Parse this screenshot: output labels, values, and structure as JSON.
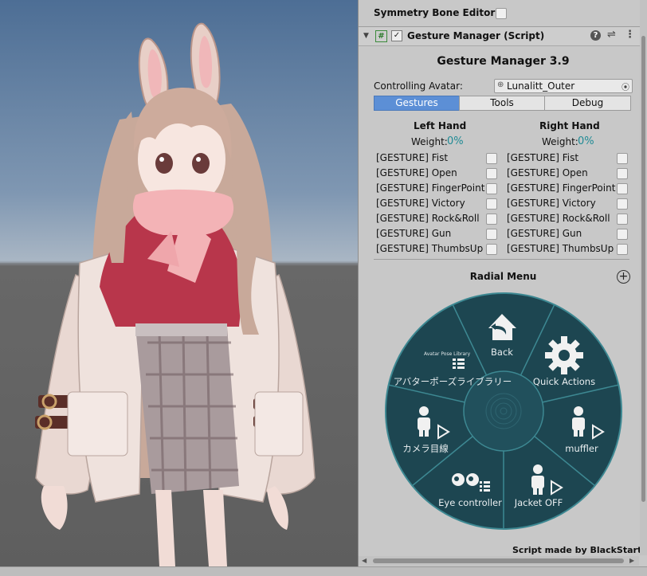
{
  "inspector": {
    "symmetry_label": "Symmetry Bone Editor",
    "component_title": "Gesture Manager (Script)",
    "heading": "Gesture Manager 3.9",
    "controlling_label": "Controlling Avatar:",
    "avatar_name": "Lunalitt_Outer",
    "tabs": [
      "Gestures",
      "Tools",
      "Debug"
    ],
    "active_tab": "Gestures",
    "left": {
      "title": "Left Hand",
      "weight_label": "Weight:",
      "weight_value": "0%"
    },
    "right": {
      "title": "Right Hand",
      "weight_label": "Weight:",
      "weight_value": "0%"
    },
    "gestures": [
      "[GESTURE] Fist",
      "[GESTURE] Open",
      "[GESTURE] FingerPoint",
      "[GESTURE] Victory",
      "[GESTURE] Rock&Roll",
      "[GESTURE] Gun",
      "[GESTURE] ThumbsUp"
    ],
    "radial_title": "Radial Menu",
    "radial_items": {
      "back": "Back",
      "quick": "Quick Actions",
      "pose": "アバターポーズライブラリー",
      "camera": "カメラ目線",
      "muffler": "muffler",
      "eye": "Eye controller",
      "jacket": "Jacket OFF"
    },
    "pose_logo_text": "Avatar Pose Library",
    "credit": "Script made by BlackStartx"
  },
  "colors": {
    "tab_active": "#5c8fd6",
    "weight_teal": "#1f8b95",
    "radial_bg": "#1d4651",
    "radial_line": "#3d8892"
  },
  "icons": [
    "hash-icon",
    "check-icon",
    "help-icon",
    "sliders-icon",
    "more-icon",
    "plus-circle-icon",
    "target-icon",
    "home-back-icon",
    "gear-icon",
    "person-icon",
    "play-icon",
    "list-icon",
    "eyes-icon"
  ]
}
